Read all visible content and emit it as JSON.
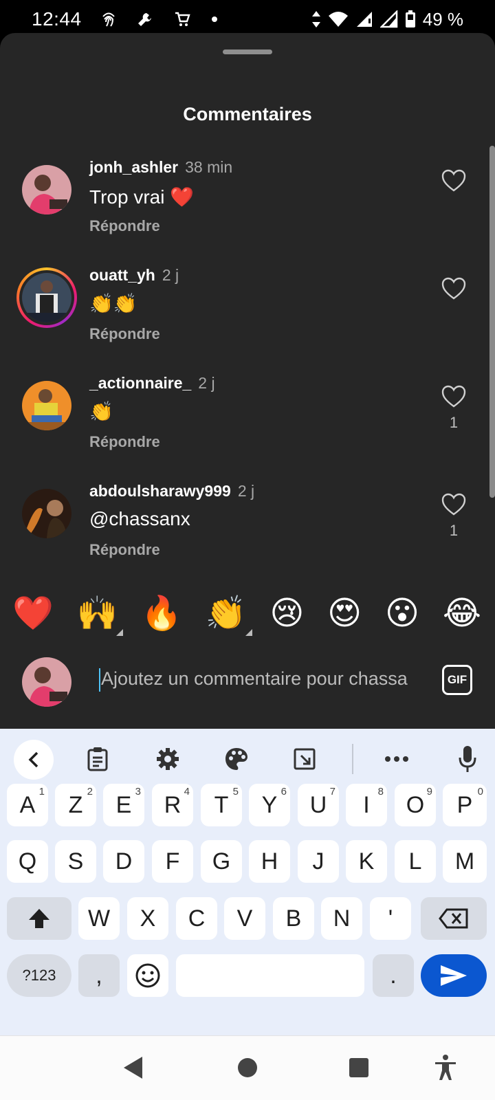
{
  "status_bar": {
    "time": "12:44",
    "battery": "49 %",
    "icons": [
      "fingerprint-icon",
      "wrench-icon",
      "cart-icon",
      "dot-icon",
      "data-arrows-icon",
      "wifi-icon",
      "signal-icon",
      "signal-icon",
      "battery-icon"
    ]
  },
  "sheet": {
    "title": "Commentaires"
  },
  "comments": [
    {
      "user": "jonh_ashler",
      "time": "38 min",
      "text": "Trop vrai ❤️",
      "reply": "Répondre",
      "likes": ""
    },
    {
      "user": "ouatt_yh",
      "time": "2 j",
      "text": "👏👏",
      "reply": "Répondre",
      "likes": ""
    },
    {
      "user": "_actionnaire_",
      "time": "2 j",
      "text": "👏",
      "reply": "Répondre",
      "likes": "1"
    },
    {
      "user": "abdoulsharawy999",
      "time": "2 j",
      "text": "@chassanx",
      "reply": "Répondre",
      "likes": "1"
    }
  ],
  "quick_emojis": [
    "❤️",
    "🙌",
    "🔥",
    "👏",
    "😢",
    "😍",
    "😮",
    "😂"
  ],
  "input": {
    "placeholder": "Ajoutez un commentaire pour chassa",
    "gif_label": "GIF"
  },
  "keyboard": {
    "row1": [
      {
        "k": "A",
        "h": "1"
      },
      {
        "k": "Z",
        "h": "2"
      },
      {
        "k": "E",
        "h": "3"
      },
      {
        "k": "R",
        "h": "4"
      },
      {
        "k": "T",
        "h": "5"
      },
      {
        "k": "Y",
        "h": "6"
      },
      {
        "k": "U",
        "h": "7"
      },
      {
        "k": "I",
        "h": "8"
      },
      {
        "k": "O",
        "h": "9"
      },
      {
        "k": "P",
        "h": "0"
      }
    ],
    "row2": [
      "Q",
      "S",
      "D",
      "F",
      "G",
      "H",
      "J",
      "K",
      "L",
      "M"
    ],
    "row3": [
      "W",
      "X",
      "C",
      "V",
      "B",
      "N",
      "'"
    ],
    "symbols_label": "?123",
    "comma": ",",
    "period": "."
  },
  "colors": {
    "sheet_bg": "#262626",
    "keyboard_bg": "#e8eefa",
    "enter_key": "#0b57d0"
  }
}
